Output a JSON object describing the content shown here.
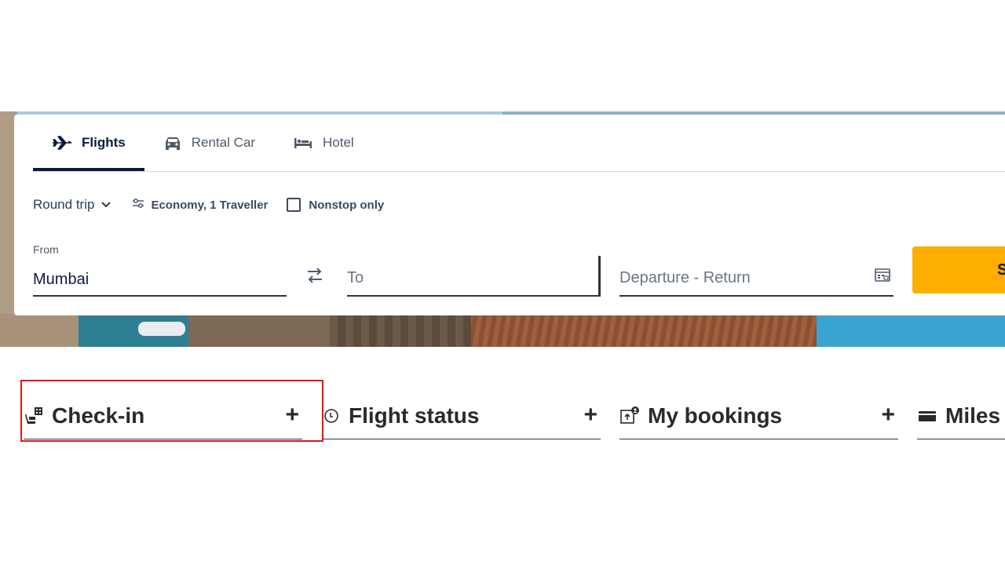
{
  "tabs": [
    {
      "label": "Flights",
      "icon": "airplane-icon",
      "active": true
    },
    {
      "label": "Rental Car",
      "icon": "car-icon",
      "active": false
    },
    {
      "label": "Hotel",
      "icon": "bed-icon",
      "active": false
    }
  ],
  "options": {
    "trip_type": "Round trip",
    "cabin_travellers": "Economy, 1 Traveller",
    "nonstop": "Nonstop only",
    "nonstop_checked": false
  },
  "search": {
    "from_label": "From",
    "from_value": "Mumbai",
    "to_placeholder": "To",
    "dates_placeholder": "Departure - Return",
    "button_label": "S"
  },
  "quick_links": [
    {
      "label": "Check-in",
      "icon": "boarding-pass-seat-icon",
      "action": "+"
    },
    {
      "label": "Flight status",
      "icon": "clock-icon",
      "action": "+"
    },
    {
      "label": "My bookings",
      "icon": "bookings-icon",
      "action": "+"
    },
    {
      "label": "Miles",
      "icon": "card-icon",
      "action": "+"
    }
  ],
  "colors": {
    "accent": "#ffad00",
    "navy": "#0b1a3b",
    "highlight": "#e01515"
  }
}
